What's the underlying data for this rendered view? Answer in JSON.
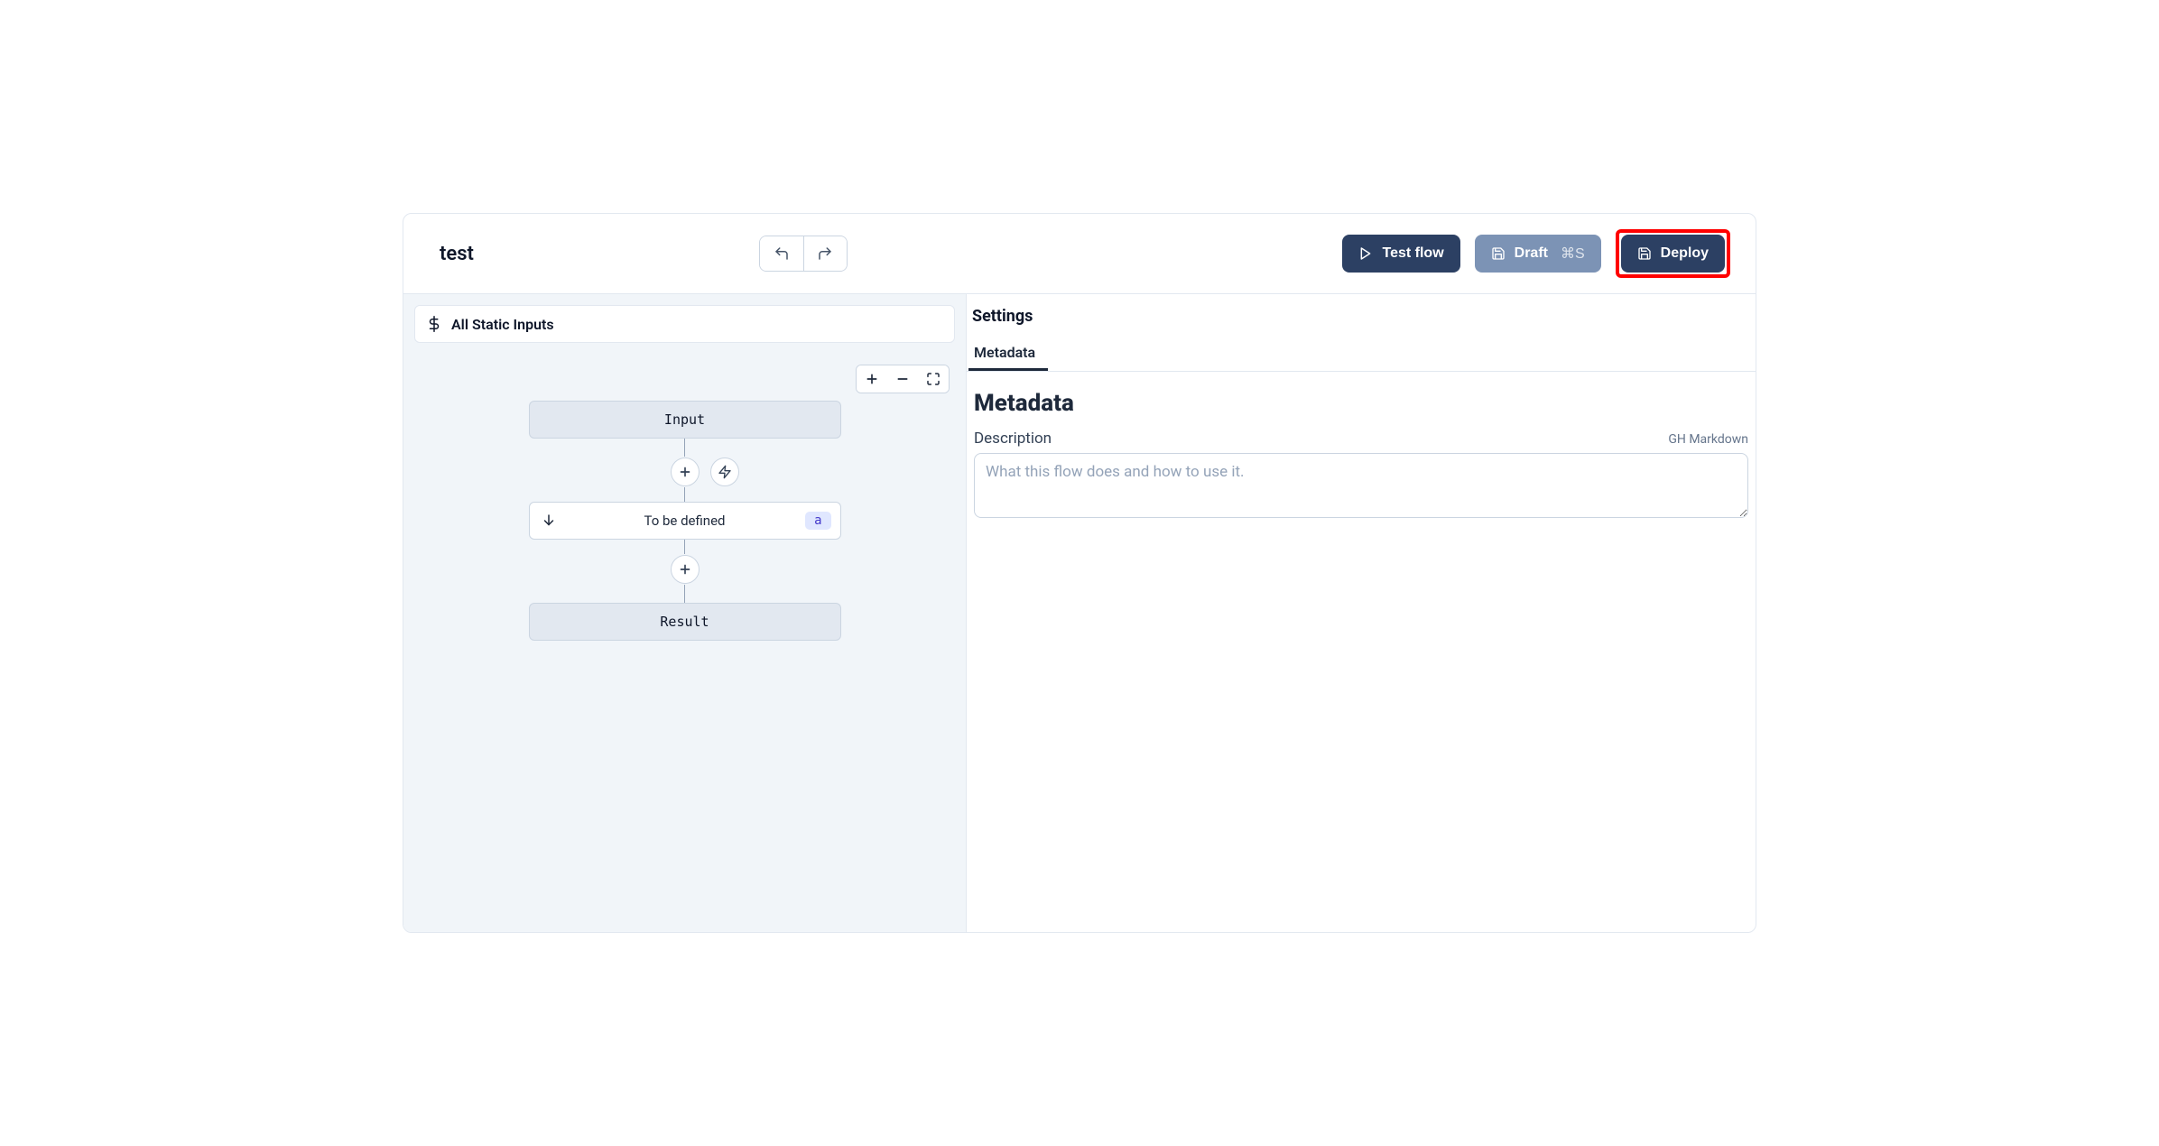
{
  "header": {
    "title": "test",
    "test_label": "Test flow",
    "draft_label": "Draft",
    "draft_shortcut": "⌘S",
    "deploy_label": "Deploy"
  },
  "left": {
    "static_inputs_label": "All Static Inputs",
    "nodes": {
      "input_label": "Input",
      "step_label": "To be defined",
      "step_tag": "a",
      "result_label": "Result"
    }
  },
  "right": {
    "settings_title": "Settings",
    "tabs": {
      "metadata": "Metadata"
    },
    "panel_heading": "Metadata",
    "description_label": "Description",
    "description_hint": "GH Markdown",
    "description_placeholder": "What this flow does and how to use it.",
    "description_value": ""
  }
}
